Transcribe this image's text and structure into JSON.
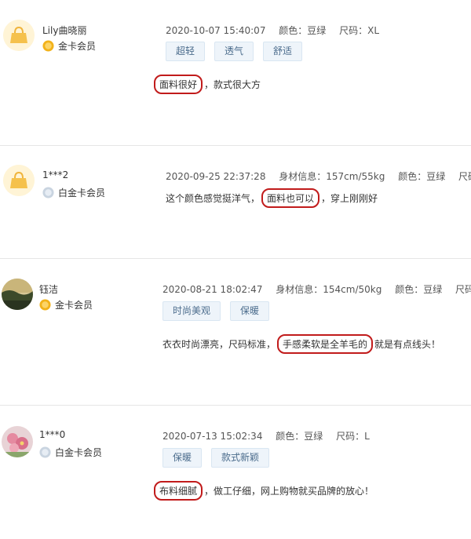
{
  "colors": {
    "highlight": "#c11b1b",
    "tag_bg": "#eef4fa",
    "gold": "#f2b21a",
    "platinum": "#c9d4e0"
  },
  "reviews": [
    {
      "username": "Lily曲晓丽",
      "member": "金卡会员",
      "member_icon": "gold-medal-icon",
      "avatar": "handbag-avatar",
      "date": "2020-10-07 15:40:07",
      "body_info": "",
      "color": "颜色：豆绿",
      "size": "尺码：XL",
      "tags": [
        "超轻",
        "透气",
        "舒适"
      ],
      "highlight": "面料很好",
      "text_before": "",
      "text_after": "，款式很大方"
    },
    {
      "username": "1***2",
      "member": "白金卡会员",
      "member_icon": "platinum-medal-icon",
      "avatar": "handbag-avatar",
      "date": "2020-09-25 22:37:28",
      "body_info": "身材信息：157cm/55kg",
      "color": "颜色：豆绿",
      "size": "尺码：L",
      "tags": [],
      "highlight": "面料也可以",
      "text_before": "这个颜色感觉挺洋气，",
      "text_after": "，穿上刚刚好"
    },
    {
      "username": "钰洁",
      "member": "金卡会员",
      "member_icon": "gold-medal-icon",
      "avatar": "landscape-avatar",
      "date": "2020-08-21 18:02:47",
      "body_info": "身材信息：154cm/50kg",
      "color": "颜色：豆绿",
      "size": "尺码：S",
      "tags": [
        "时尚美观",
        "保暖"
      ],
      "highlight": "手感柔软是全羊毛的",
      "text_before": "衣衣时尚漂亮，尺码标准，",
      "text_after": "就是有点线头！"
    },
    {
      "username": "1***0",
      "member": "白金卡会员",
      "member_icon": "platinum-medal-icon",
      "avatar": "flower-avatar",
      "date": "2020-07-13 15:02:34",
      "body_info": "",
      "color": "颜色：豆绿",
      "size": "尺码：L",
      "tags": [
        "保暖",
        "款式新颖"
      ],
      "highlight": "布料细腻",
      "text_before": "",
      "text_after": "，做工仔细，网上购物就买品牌的放心！"
    }
  ]
}
